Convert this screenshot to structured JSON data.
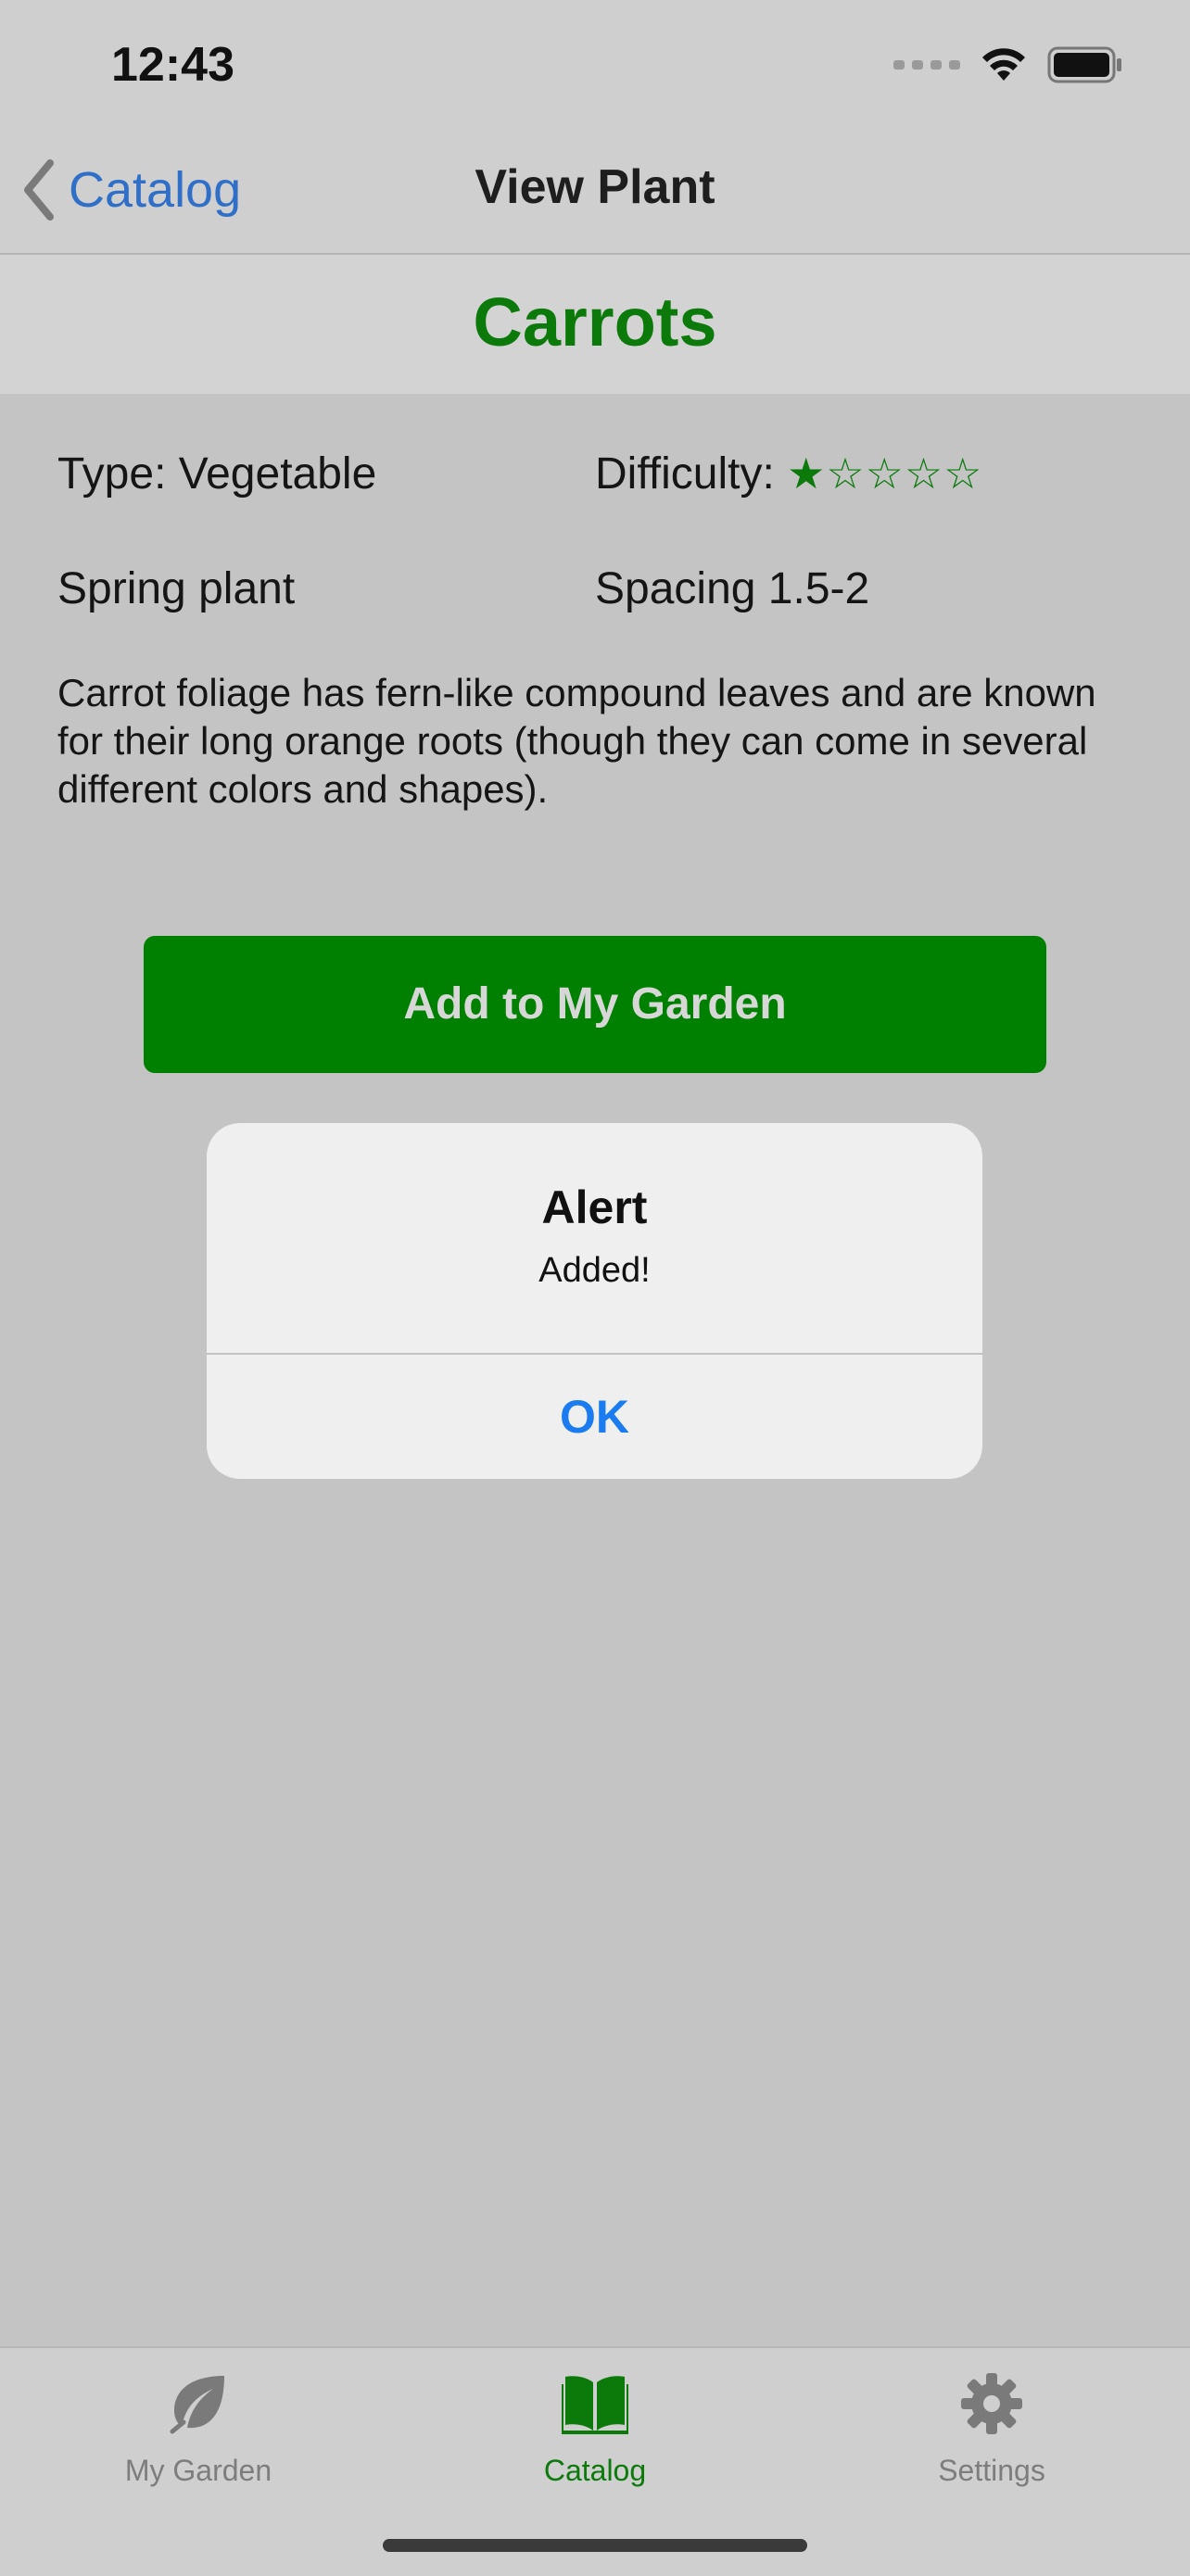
{
  "status_bar": {
    "time": "12:43",
    "icons": [
      "signal-icon",
      "wifi-icon",
      "battery-icon"
    ]
  },
  "nav": {
    "back_label": "Catalog",
    "title": "View Plant"
  },
  "plant": {
    "name": "Carrots",
    "type_label": "Type: Vegetable",
    "difficulty_label": "Difficulty:",
    "difficulty_rating": 1,
    "difficulty_max": 5,
    "difficulty_stars": "★☆☆☆☆",
    "season": "Spring plant",
    "spacing": "Spacing 1.5-2",
    "description": "Carrot foliage has fern-like compound leaves and are known for their long orange roots (though they can come in several different colors and shapes)."
  },
  "add_button_label": "Add to My Garden",
  "alert": {
    "title": "Alert",
    "message": "Added!",
    "ok_label": "OK"
  },
  "tabs": [
    {
      "label": "My Garden",
      "icon": "leaf-icon",
      "active": false
    },
    {
      "label": "Catalog",
      "icon": "book-icon",
      "active": true
    },
    {
      "label": "Settings",
      "icon": "gear-icon",
      "active": false
    }
  ],
  "colors": {
    "accent_green": "#0b7a0b",
    "button_green": "#008000",
    "link_blue": "#2f6fc8",
    "alert_blue": "#1a7cf0",
    "inactive_tab": "#7d7d7d"
  }
}
